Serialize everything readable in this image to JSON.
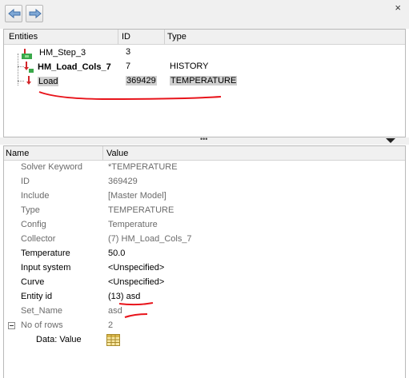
{
  "toolbar": {
    "back_icon": "arrow-left-icon",
    "forward_icon": "arrow-right-icon",
    "close_label": "×"
  },
  "tree": {
    "columns": {
      "entities": "Entities",
      "id": "ID",
      "type": "Type"
    },
    "rows": [
      {
        "name": "HM_Step_3",
        "id": "3",
        "type": "",
        "icon": "step-icon"
      },
      {
        "name": "HM_Load_Cols_7",
        "id": "7",
        "type": "HISTORY",
        "icon": "load-collector-icon"
      },
      {
        "name": "Load",
        "id": "369429",
        "type": "TEMPERATURE",
        "icon": "load-icon"
      }
    ]
  },
  "splitter": {
    "grip": "•••"
  },
  "properties": {
    "columns": {
      "name": "Name",
      "value": "Value"
    },
    "rows": [
      {
        "name": "Solver Keyword",
        "value": "*TEMPERATURE"
      },
      {
        "name": "ID",
        "value": "369429"
      },
      {
        "name": "Include",
        "value": "[Master Model]"
      },
      {
        "name": "Type",
        "value": "TEMPERATURE"
      },
      {
        "name": "Config",
        "value": "Temperature"
      },
      {
        "name": "Collector",
        "value": "(7) HM_Load_Cols_7"
      },
      {
        "name": "Temperature",
        "value": "50.0"
      },
      {
        "name": "Input system",
        "value": "<Unspecified>"
      },
      {
        "name": "Curve",
        "value": "<Unspecified>"
      },
      {
        "name": "Entity id",
        "value": "(13) asd"
      },
      {
        "name": "Set_Name",
        "value": "asd"
      },
      {
        "name": "No of rows",
        "value": "2"
      },
      {
        "name": "Data: Value",
        "value": ""
      }
    ]
  },
  "colors": {
    "annotation_red": "#e8141b",
    "selection_gray": "#cfcfcf",
    "panel_bg": "#f0f0f0"
  }
}
